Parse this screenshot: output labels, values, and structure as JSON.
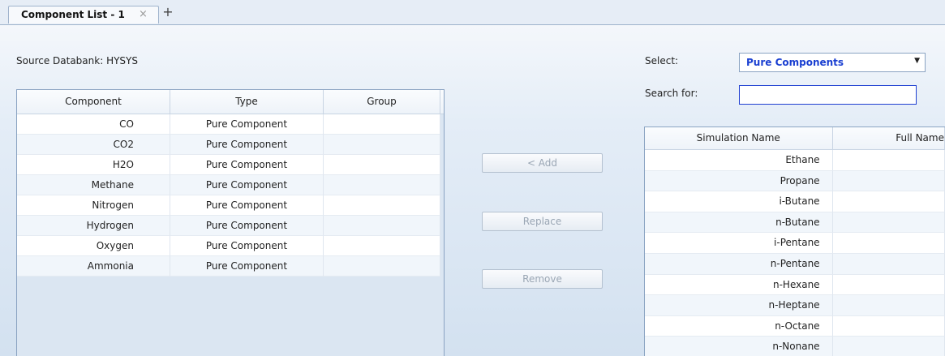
{
  "tab": {
    "label": "Component List - 1",
    "close": "×",
    "add": "+"
  },
  "source": {
    "label": "Source Databank: HYSYS"
  },
  "left_grid": {
    "columns": [
      "Component",
      "Type",
      "Group"
    ],
    "rows": [
      {
        "component": "CO",
        "type": "Pure Component",
        "group": ""
      },
      {
        "component": "CO2",
        "type": "Pure Component",
        "group": ""
      },
      {
        "component": "H2O",
        "type": "Pure Component",
        "group": ""
      },
      {
        "component": "Methane",
        "type": "Pure Component",
        "group": ""
      },
      {
        "component": "Nitrogen",
        "type": "Pure Component",
        "group": ""
      },
      {
        "component": "Hydrogen",
        "type": "Pure Component",
        "group": ""
      },
      {
        "component": "Oxygen",
        "type": "Pure Component",
        "group": ""
      },
      {
        "component": "Ammonia",
        "type": "Pure Component",
        "group": ""
      }
    ]
  },
  "buttons": {
    "add": "< Add",
    "replace": "Replace",
    "remove": "Remove"
  },
  "select": {
    "label": "Select:",
    "value": "Pure Components"
  },
  "search": {
    "label": "Search for:",
    "value": ""
  },
  "right_grid": {
    "columns": [
      "Simulation Name",
      "Full Name"
    ],
    "rows": [
      "Ethane",
      "Propane",
      "i-Butane",
      "n-Butane",
      "i-Pentane",
      "n-Pentane",
      "n-Hexane",
      "n-Heptane",
      "n-Octane",
      "n-Nonane"
    ]
  }
}
